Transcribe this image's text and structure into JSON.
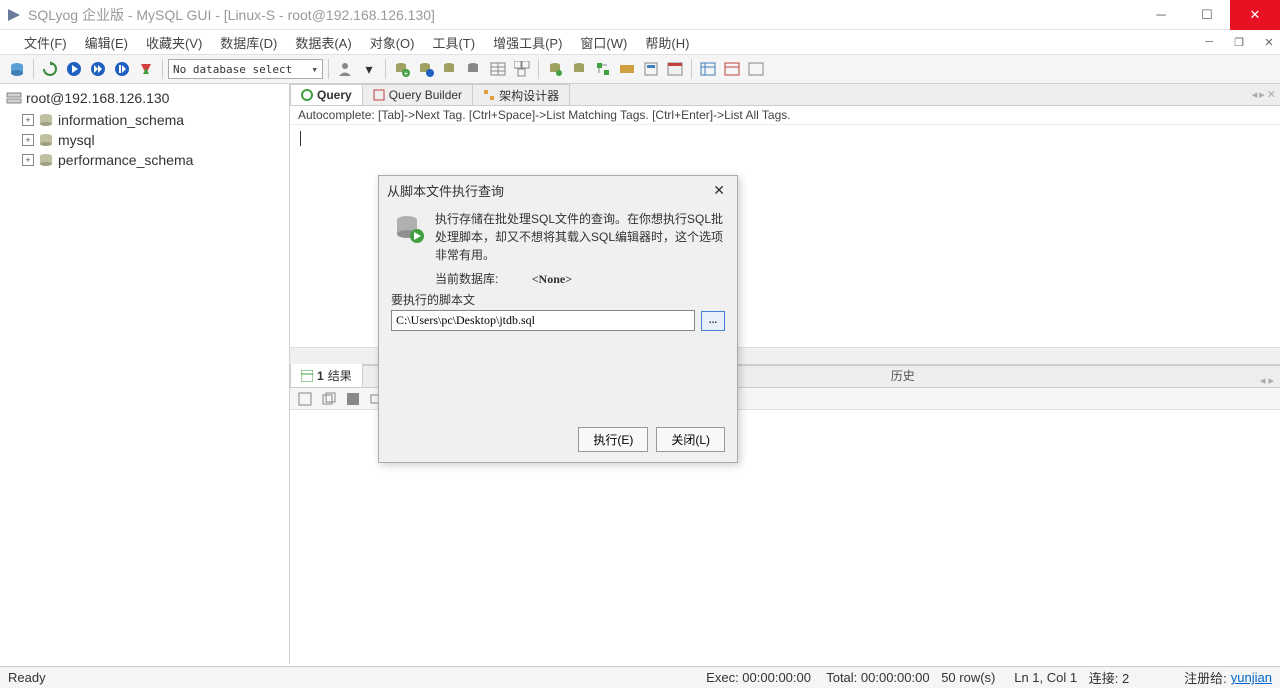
{
  "title": "SQLyog 企业版 - MySQL GUI - [Linux-S - root@192.168.126.130]",
  "menu": {
    "file": "文件(F)",
    "edit": "编辑(E)",
    "fav": "收藏夹(V)",
    "db": "数据库(D)",
    "table": "数据表(A)",
    "obj": "对象(O)",
    "tool": "工具(T)",
    "adv": "增强工具(P)",
    "win": "窗口(W)",
    "help": "帮助(H)"
  },
  "db_select": "No database select",
  "sidebar": {
    "root": "root@192.168.126.130",
    "items": [
      "information_schema",
      "mysql",
      "performance_schema"
    ]
  },
  "tabs": {
    "query": "Query",
    "builder": "Query Builder",
    "designer": "架构设计器"
  },
  "hint": "Autocomplete: [Tab]->Next Tag. [Ctrl+Space]->List Matching Tags. [Ctrl+Enter]->List All Tags.",
  "lower": {
    "tab1_num": "1",
    "tab1_label": "结果",
    "history": "历史"
  },
  "dialog": {
    "title": "从脚本文件执行查询",
    "desc": "执行存储在批处理SQL文件的查询。在你想执行SQL批处理脚本，却又不想将其载入SQL编辑器时，这个选项非常有用。",
    "curdb_label": "当前数据库:",
    "curdb_value": "<None>",
    "script_label": "要执行的脚本文",
    "script_path": "C:\\Users\\pc\\Desktop\\jtdb.sql",
    "browse": "...",
    "execute": "执行(E)",
    "close": "关闭(L)"
  },
  "status": {
    "ready": "Ready",
    "exec": "Exec: 00:00:00:00",
    "total": "Total: 00:00:00:00",
    "rows": "50 row(s)",
    "ln": "Ln 1, Col 1",
    "conn": "连接: 2",
    "reg_label": "注册给:",
    "reg_name": "yunjian"
  }
}
